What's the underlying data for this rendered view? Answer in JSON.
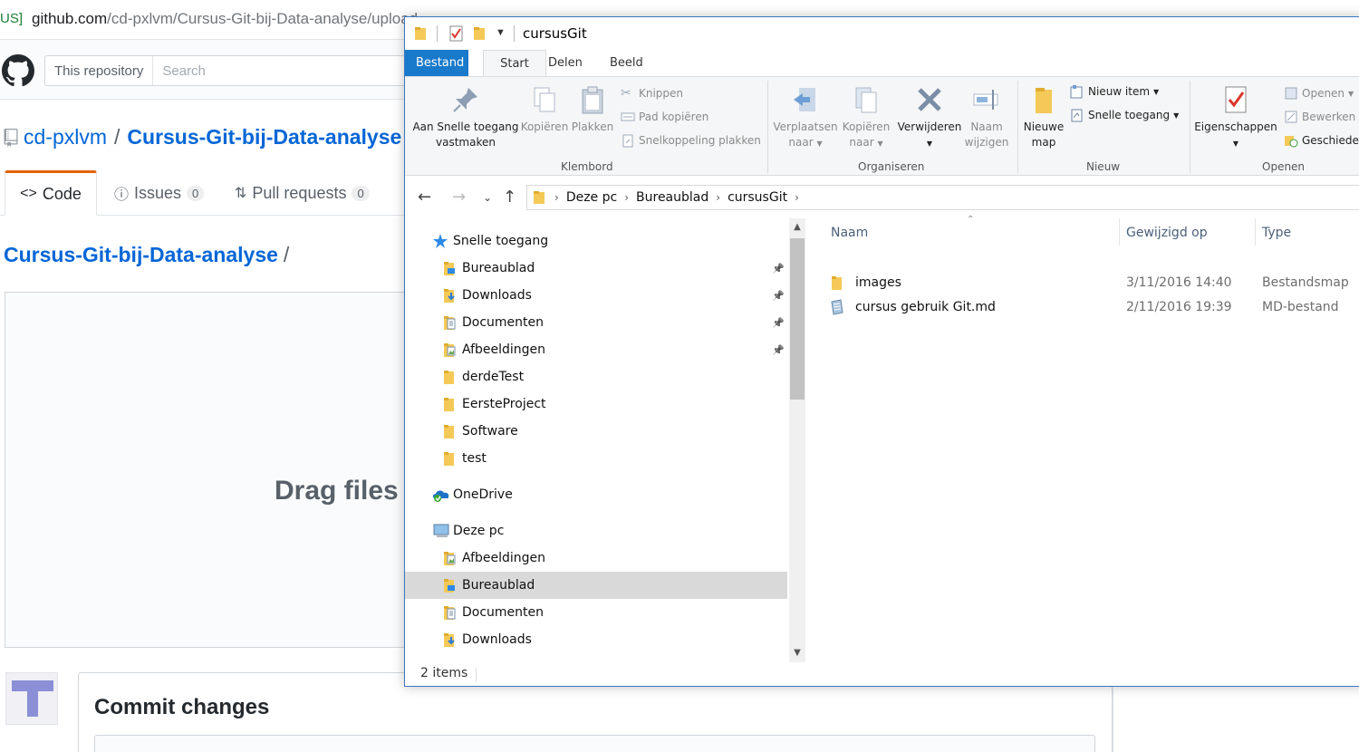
{
  "browser": {
    "url_prefix": "US]",
    "url_host": "github.com",
    "url_path": "/cd-pxlvm/Cursus-Git-bij-Data-analyse/upload"
  },
  "github": {
    "search_scope": "This repository",
    "search_placeholder": "Search",
    "owner": "cd-pxlvm",
    "separator": "/",
    "repo": "Cursus-Git-bij-Data-analyse",
    "tabs": {
      "code": "Code",
      "issues": "Issues",
      "issues_count": "0",
      "pulls": "Pull requests",
      "pulls_count": "0"
    },
    "path_title": "Cursus-Git-bij-Data-analyse",
    "path_slash": "/",
    "drag_text": "Drag files h",
    "commit_title": "Commit changes",
    "avatar_letter": "T"
  },
  "explorer": {
    "title": "cursusGit",
    "ribbon_tabs": [
      "Bestand",
      "Start",
      "Delen",
      "Beeld"
    ],
    "clipboard": {
      "pin_label_1": "Aan Snelle toegang",
      "pin_label_2": "vastmaken",
      "copy": "Kopiëren",
      "paste": "Plakken",
      "cut": "Knippen",
      "copy_path": "Pad kopiëren",
      "paste_shortcut": "Snelkoppeling plakken",
      "group": "Klembord"
    },
    "organize": {
      "move_1": "Verplaatsen",
      "move_2": "naar",
      "copyto_1": "Kopiëren",
      "copyto_2": "naar",
      "delete": "Verwijderen",
      "rename_1": "Naam",
      "rename_2": "wijzigen",
      "group": "Organiseren"
    },
    "new": {
      "folder_1": "Nieuwe",
      "folder_2": "map",
      "new_item": "Nieuw item",
      "easy_access": "Snelle toegang",
      "group": "Nieuw"
    },
    "open": {
      "properties": "Eigenschappen",
      "open": "Openen",
      "edit": "Bewerken",
      "history": "Geschieden",
      "group": "Openen"
    },
    "breadcrumb": [
      "Deze pc",
      "Bureaublad",
      "cursusGit"
    ],
    "nav_tree": [
      {
        "label": "Snelle toegang",
        "icon": "star-icon",
        "indent": 1,
        "pinned": false
      },
      {
        "label": "Bureaublad",
        "icon": "folder-desktop-icon",
        "indent": 2,
        "pinned": true
      },
      {
        "label": "Downloads",
        "icon": "folder-downloads-icon",
        "indent": 2,
        "pinned": true
      },
      {
        "label": "Documenten",
        "icon": "folder-documents-icon",
        "indent": 2,
        "pinned": true
      },
      {
        "label": "Afbeeldingen",
        "icon": "folder-pictures-icon",
        "indent": 2,
        "pinned": true
      },
      {
        "label": "derdeTest",
        "icon": "folder-icon",
        "indent": 2,
        "pinned": false
      },
      {
        "label": "EersteProject",
        "icon": "folder-icon",
        "indent": 2,
        "pinned": false
      },
      {
        "label": "Software",
        "icon": "folder-icon",
        "indent": 2,
        "pinned": false
      },
      {
        "label": "test",
        "icon": "folder-icon",
        "indent": 2,
        "pinned": false
      },
      {
        "label": "OneDrive",
        "icon": "onedrive-icon",
        "indent": 1,
        "pinned": false
      },
      {
        "label": "Deze pc",
        "icon": "computer-icon",
        "indent": 1,
        "pinned": false
      },
      {
        "label": "Afbeeldingen",
        "icon": "folder-pictures-icon",
        "indent": 2,
        "pinned": false
      },
      {
        "label": "Bureaublad",
        "icon": "folder-desktop-icon",
        "indent": 2,
        "pinned": false,
        "selected": true
      },
      {
        "label": "Documenten",
        "icon": "folder-documents-icon",
        "indent": 2,
        "pinned": false
      },
      {
        "label": "Downloads",
        "icon": "folder-downloads-icon",
        "indent": 2,
        "pinned": false
      }
    ],
    "columns": {
      "name": "Naam",
      "modified": "Gewijzigd op",
      "type": "Type"
    },
    "files": [
      {
        "name": "images",
        "modified": "3/11/2016 14:40",
        "type": "Bestandsmap",
        "icon": "folder-icon"
      },
      {
        "name": "cursus gebruik Git.md",
        "modified": "2/11/2016 19:39",
        "type": "MD-bestand",
        "icon": "md-file-icon"
      }
    ],
    "status": "2 items"
  }
}
